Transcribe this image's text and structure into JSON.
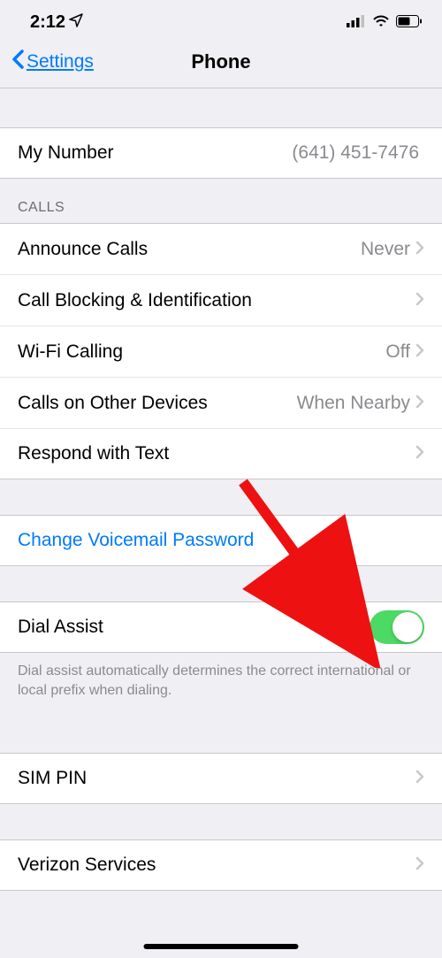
{
  "status": {
    "time": "2:12"
  },
  "nav": {
    "back": "Settings",
    "title": "Phone"
  },
  "myNumber": {
    "label": "My Number",
    "value": "(641) 451-7476"
  },
  "calls": {
    "header": "CALLS",
    "items": [
      {
        "label": "Announce Calls",
        "value": "Never"
      },
      {
        "label": "Call Blocking & Identification",
        "value": ""
      },
      {
        "label": "Wi-Fi Calling",
        "value": "Off"
      },
      {
        "label": "Calls on Other Devices",
        "value": "When Nearby"
      },
      {
        "label": "Respond with Text",
        "value": ""
      }
    ]
  },
  "voicemail": {
    "label": "Change Voicemail Password"
  },
  "dialAssist": {
    "label": "Dial Assist",
    "footer": "Dial assist automatically determines the correct international or local prefix when dialing."
  },
  "simPin": {
    "label": "SIM PIN"
  },
  "verizon": {
    "label": "Verizon Services"
  }
}
